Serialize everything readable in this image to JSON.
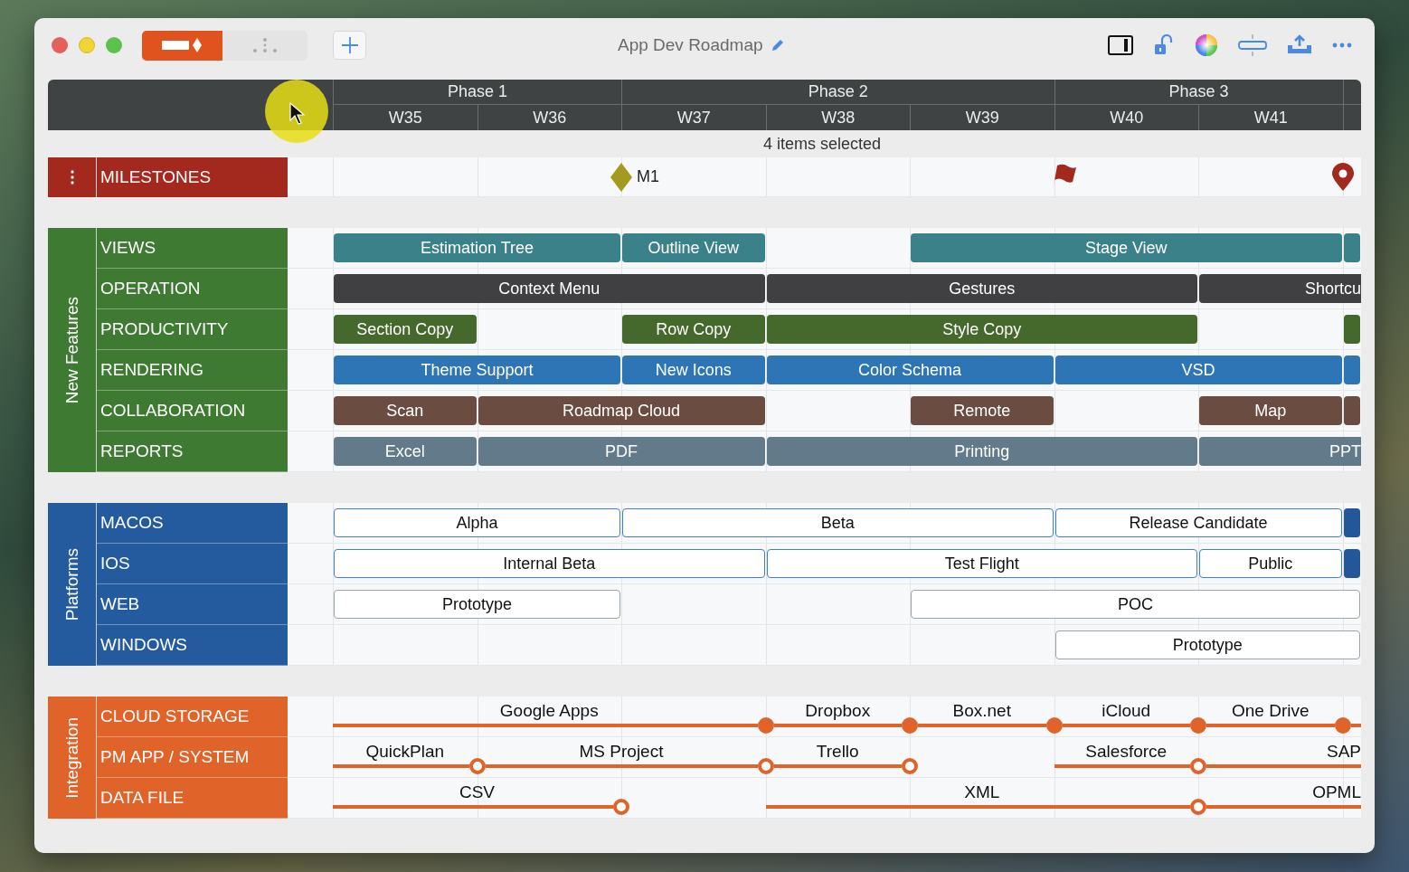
{
  "window": {
    "title": "App Dev Roadmap"
  },
  "toolbar": {
    "view_modes": [
      {
        "kind": "timeline",
        "selected": true
      },
      {
        "kind": "tree",
        "selected": false
      }
    ]
  },
  "header": {
    "phases": [
      {
        "label": "Phase 1",
        "weeks": [
          "W35",
          "W36"
        ]
      },
      {
        "label": "Phase 2",
        "weeks": [
          "W37",
          "W38",
          "W39"
        ]
      },
      {
        "label": "Phase 3",
        "weeks": [
          "W40",
          "W41"
        ]
      }
    ]
  },
  "selection_status": "4 items selected",
  "milestones": {
    "label": "MILESTONES",
    "color": "#a3281e",
    "slots": [
      {
        "kind": "empty"
      },
      {
        "kind": "empty"
      },
      {
        "kind": "diamond",
        "label": "M1"
      },
      {
        "kind": "empty"
      },
      {
        "kind": "empty"
      },
      {
        "kind": "flag"
      },
      {
        "kind": "empty"
      },
      {
        "kind": "pin"
      }
    ]
  },
  "groups": [
    {
      "label": "New Features",
      "kind": "bars",
      "color": "#3f7a33",
      "rows": [
        {
          "label": "VIEWS",
          "color": "#3a8189",
          "slots": [
            {
              "kind": "bar",
              "label": "Estimation Tree"
            },
            {
              "kind": "cont"
            },
            {
              "kind": "bar",
              "label": "Outline View"
            },
            {
              "kind": "empty"
            },
            {
              "kind": "bar",
              "label": "Stage View"
            },
            {
              "kind": "cont"
            },
            {
              "kind": "cont"
            },
            {
              "kind": "bar"
            }
          ]
        },
        {
          "label": "OPERATION",
          "color": "#404043",
          "slots": [
            {
              "kind": "bar",
              "label": "Context Menu"
            },
            {
              "kind": "cont"
            },
            {
              "kind": "cont"
            },
            {
              "kind": "bar",
              "label": "Gestures"
            },
            {
              "kind": "cont"
            },
            {
              "kind": "cont"
            },
            {
              "kind": "bar",
              "label": "Shortcu",
              "cut": true
            },
            {
              "kind": "cont"
            }
          ]
        },
        {
          "label": "PRODUCTIVITY",
          "color": "#45692c",
          "slots": [
            {
              "kind": "bar",
              "label": "Section Copy"
            },
            {
              "kind": "empty"
            },
            {
              "kind": "bar",
              "label": "Row Copy"
            },
            {
              "kind": "bar",
              "label": "Style Copy"
            },
            {
              "kind": "cont"
            },
            {
              "kind": "cont"
            },
            {
              "kind": "empty"
            },
            {
              "kind": "bar"
            }
          ]
        },
        {
          "label": "RENDERING",
          "color": "#2e75b6",
          "slots": [
            {
              "kind": "bar",
              "label": "Theme Support"
            },
            {
              "kind": "cont"
            },
            {
              "kind": "bar",
              "label": "New Icons"
            },
            {
              "kind": "bar",
              "label": "Color Schema"
            },
            {
              "kind": "cont"
            },
            {
              "kind": "bar",
              "label": "VSD"
            },
            {
              "kind": "cont"
            },
            {
              "kind": "bar"
            }
          ]
        },
        {
          "label": "COLLABORATION",
          "color": "#6a4c41",
          "slots": [
            {
              "kind": "bar",
              "label": "Scan"
            },
            {
              "kind": "bar",
              "label": "Roadmap Cloud"
            },
            {
              "kind": "cont"
            },
            {
              "kind": "empty"
            },
            {
              "kind": "bar",
              "label": "Remote"
            },
            {
              "kind": "empty"
            },
            {
              "kind": "bar",
              "label": "Map"
            },
            {
              "kind": "bar"
            }
          ]
        },
        {
          "label": "REPORTS",
          "color": "#637a8a",
          "slots": [
            {
              "kind": "bar",
              "label": "Excel"
            },
            {
              "kind": "bar",
              "label": "PDF"
            },
            {
              "kind": "cont"
            },
            {
              "kind": "bar",
              "label": "Printing"
            },
            {
              "kind": "cont"
            },
            {
              "kind": "cont"
            },
            {
              "kind": "bar",
              "label": "PPT",
              "cut": true
            },
            {
              "kind": "cont"
            }
          ]
        }
      ]
    },
    {
      "label": "Platforms",
      "kind": "bars",
      "color": "#245a9e",
      "rows": [
        {
          "label": "MACOS",
          "color": "#3d80d0",
          "slots": [
            {
              "kind": "outline",
              "label": "Alpha"
            },
            {
              "kind": "cont"
            },
            {
              "kind": "outline",
              "label": "Beta"
            },
            {
              "kind": "cont"
            },
            {
              "kind": "cont"
            },
            {
              "kind": "outline",
              "label": "Release Candidate"
            },
            {
              "kind": "cont"
            },
            {
              "kind": "bar"
            }
          ]
        },
        {
          "label": "IOS",
          "color": "#3d80d0",
          "slots": [
            {
              "kind": "outline",
              "label": "Internal Beta"
            },
            {
              "kind": "cont"
            },
            {
              "kind": "cont"
            },
            {
              "kind": "outline",
              "label": "Test Flight"
            },
            {
              "kind": "cont"
            },
            {
              "kind": "cont"
            },
            {
              "kind": "outline",
              "label": "Public"
            },
            {
              "kind": "bar"
            }
          ]
        },
        {
          "label": "WEB",
          "color": "#9aa4ad",
          "slots": [
            {
              "kind": "outline",
              "label": "Prototype"
            },
            {
              "kind": "cont"
            },
            {
              "kind": "empty"
            },
            {
              "kind": "empty"
            },
            {
              "kind": "outline",
              "label": "POC"
            },
            {
              "kind": "cont"
            },
            {
              "kind": "cont"
            },
            {
              "kind": "cont"
            }
          ]
        },
        {
          "label": "WINDOWS",
          "color": "#9aa4ad",
          "slots": [
            {
              "kind": "empty"
            },
            {
              "kind": "empty"
            },
            {
              "kind": "empty"
            },
            {
              "kind": "empty"
            },
            {
              "kind": "empty"
            },
            {
              "kind": "outline",
              "label": "Prototype"
            },
            {
              "kind": "cont"
            },
            {
              "kind": "cont"
            }
          ]
        }
      ]
    },
    {
      "label": "Integration",
      "kind": "lines",
      "color": "#e0632a",
      "rows": [
        {
          "label": "CLOUD STORAGE",
          "slots": [
            {
              "kind": "segment",
              "label": "Google Apps"
            },
            {
              "kind": "cont"
            },
            {
              "kind": "cont",
              "end_marker": true,
              "filled": true
            },
            {
              "kind": "segment",
              "label": "Dropbox",
              "end_marker": true,
              "filled": true
            },
            {
              "kind": "segment",
              "label": "Box.net",
              "end_marker": true,
              "filled": true
            },
            {
              "kind": "segment",
              "label": "iCloud",
              "end_marker": true,
              "filled": true
            },
            {
              "kind": "segment",
              "label": "One Drive",
              "end_marker": true,
              "filled": true
            },
            {
              "kind": "segment"
            }
          ]
        },
        {
          "label": "PM APP / SYSTEM",
          "slots": [
            {
              "kind": "segment",
              "label": "QuickPlan",
              "end_marker": true,
              "filled": false
            },
            {
              "kind": "segment",
              "label": "MS Project"
            },
            {
              "kind": "cont",
              "end_marker": true,
              "filled": false
            },
            {
              "kind": "segment",
              "label": "Trello",
              "end_marker": true,
              "filled": false
            },
            {
              "kind": "empty"
            },
            {
              "kind": "segment",
              "label": "Salesforce",
              "end_marker": true,
              "filled": false
            },
            {
              "kind": "segment",
              "label": "SAP",
              "cut": true
            },
            {
              "kind": "cont"
            }
          ]
        },
        {
          "label": "DATA FILE",
          "slots": [
            {
              "kind": "segment",
              "label": "CSV"
            },
            {
              "kind": "cont",
              "end_marker": true,
              "filled": false
            },
            {
              "kind": "empty"
            },
            {
              "kind": "segment",
              "label": "XML"
            },
            {
              "kind": "cont"
            },
            {
              "kind": "cont",
              "end_marker": true,
              "filled": false
            },
            {
              "kind": "segment",
              "label": "OPML",
              "cut": true
            },
            {
              "kind": "cont"
            }
          ]
        }
      ]
    }
  ]
}
